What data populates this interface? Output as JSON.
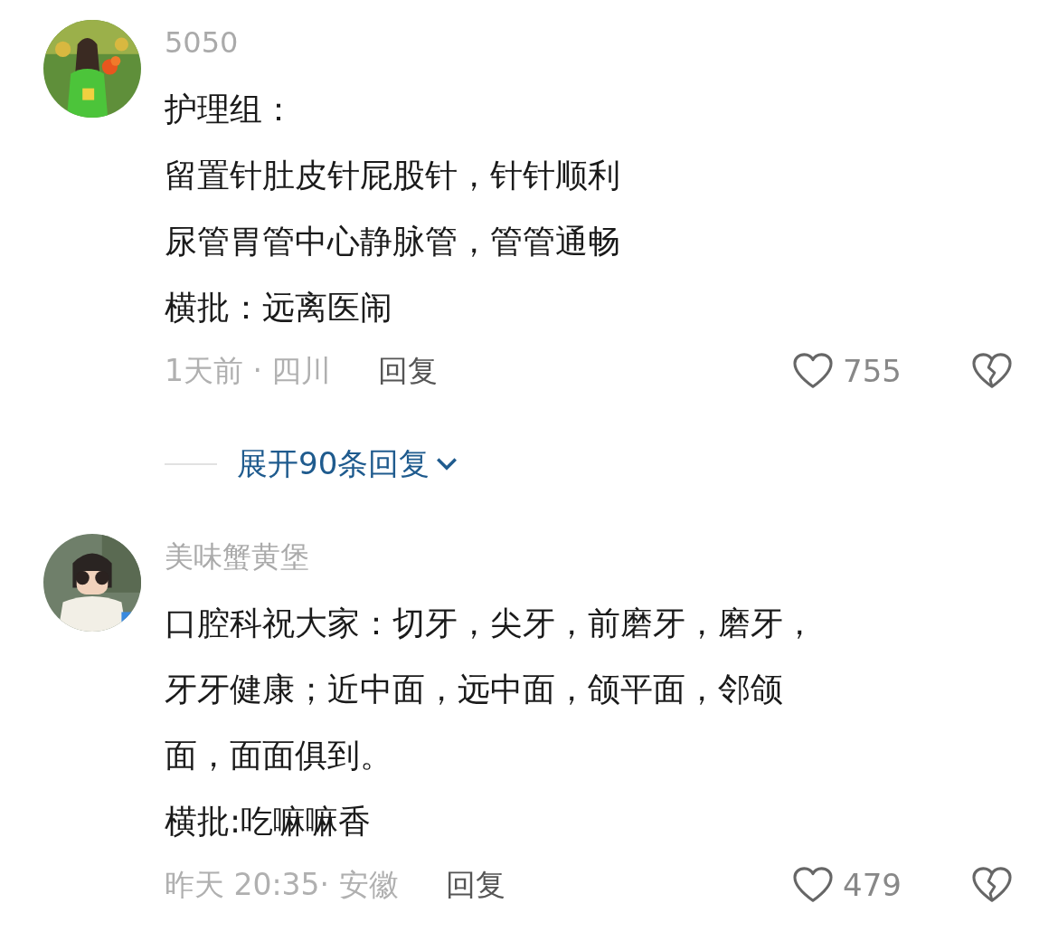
{
  "comments": [
    {
      "username": "5050",
      "lines": [
        "护理组：",
        "留置针肚皮针屁股针，针针顺利",
        "尿管胃管中心静脉管，管管通畅",
        "横批：远离医闹"
      ],
      "time_location": "1天前 · 四川",
      "reply": "回复",
      "likes": "755",
      "expand_replies": "展开90条回复"
    },
    {
      "username": "美味蟹黄堡",
      "lines": [
        "口腔科祝大家：切牙，尖牙，前磨牙，磨牙，",
        "牙牙健康；近中面，远中面，颌平面，邻颌",
        "面，面面俱到。",
        "横批:吃嘛嘛香"
      ],
      "time_location": "昨天 20:35· 安徽",
      "reply": "回复",
      "likes": "479"
    }
  ]
}
